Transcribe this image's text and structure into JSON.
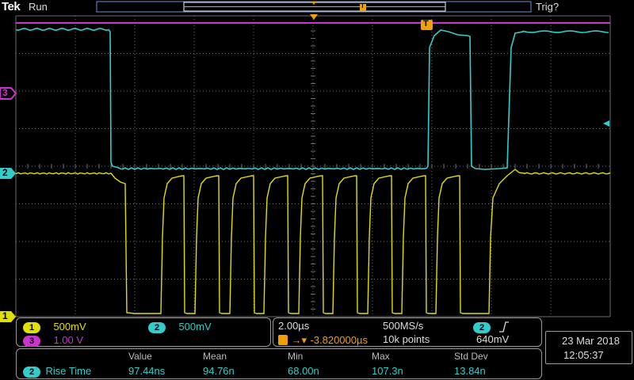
{
  "header": {
    "brand": "Tek",
    "status": "Run",
    "trigger_state": "Trig?",
    "trigger_marker": "T"
  },
  "colors": {
    "ch1": "#e0e000",
    "ch2": "#33cccc",
    "ch3": "#cc33cc",
    "trigger": "#f0a000",
    "grid": "#6e6e6e",
    "border": "#9a9a9a"
  },
  "markers": {
    "ch1": "1",
    "ch2": "2",
    "ch3": "3"
  },
  "channels": [
    {
      "id": "1",
      "scale": "500mV"
    },
    {
      "id": "2",
      "scale": "500mV"
    },
    {
      "id": "3",
      "scale": "1.00 V"
    }
  ],
  "timebase": {
    "scale": "2.00µs",
    "sample_rate": "500MS/s",
    "delay": "-3.820000µs",
    "record_length": "10k points",
    "trigger_source": "2",
    "trigger_slope_icon": "rising-edge-icon",
    "trigger_level": "640mV"
  },
  "datetime": {
    "date": "23 Mar  2018",
    "time": "12:05:37"
  },
  "measurement": {
    "headers": [
      "Value",
      "Mean",
      "Min",
      "Max",
      "Std Dev"
    ],
    "channel": "2",
    "name": "Rise Time",
    "values": [
      "97.44ns",
      "94.76n",
      "68.00n",
      "107.3n",
      "13.84n"
    ]
  }
}
